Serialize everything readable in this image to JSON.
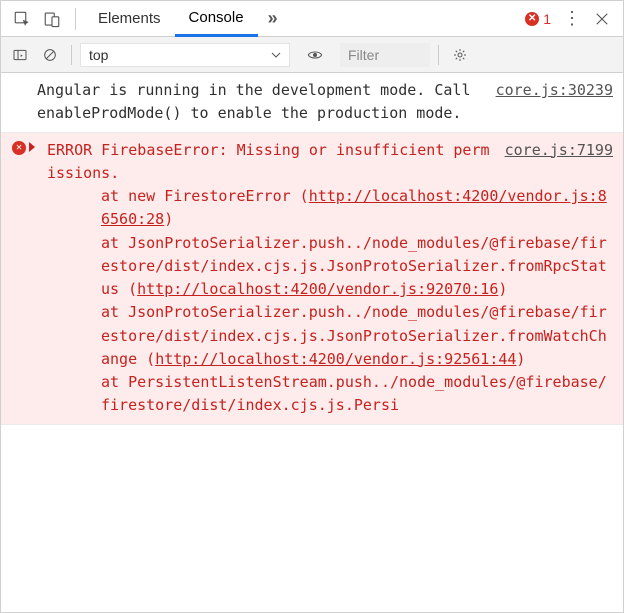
{
  "tabs": {
    "elements": "Elements",
    "console": "Console"
  },
  "errorBadge": {
    "count": "1"
  },
  "toolbar": {
    "context": "top",
    "filter_placeholder": "Filter"
  },
  "log": {
    "info": {
      "source": "core.js:30239",
      "text": "Angular is running in the development mode. Call enableProdMode() to enable the production mode."
    },
    "error": {
      "source": "core.js:7199",
      "heading": "ERROR FirebaseError: Missing or insufficient permissions.",
      "frames": [
        {
          "at": "at new FirestoreError (",
          "url": "http://localhost:4200/vendor.js:86560:28",
          "tail": ")"
        },
        {
          "at": "at JsonProtoSerializer.push../node_modules/@firebase/firestore/dist/index.cjs.js.JsonProtoSerializer.fromRpcStatus (",
          "url": "http://localhost:4200/vendor.js:92070:16",
          "tail": ")"
        },
        {
          "at": "at JsonProtoSerializer.push../node_modules/@firebase/firestore/dist/index.cjs.js.JsonProtoSerializer.fromWatchChange (",
          "url": "http://localhost:4200/vendor.js:92561:44",
          "tail": ")"
        },
        {
          "at": "at PersistentListenStream.push../node_modules/@firebase/firestore/dist/index.cjs.js.Persi",
          "url": "",
          "tail": ""
        }
      ]
    }
  }
}
